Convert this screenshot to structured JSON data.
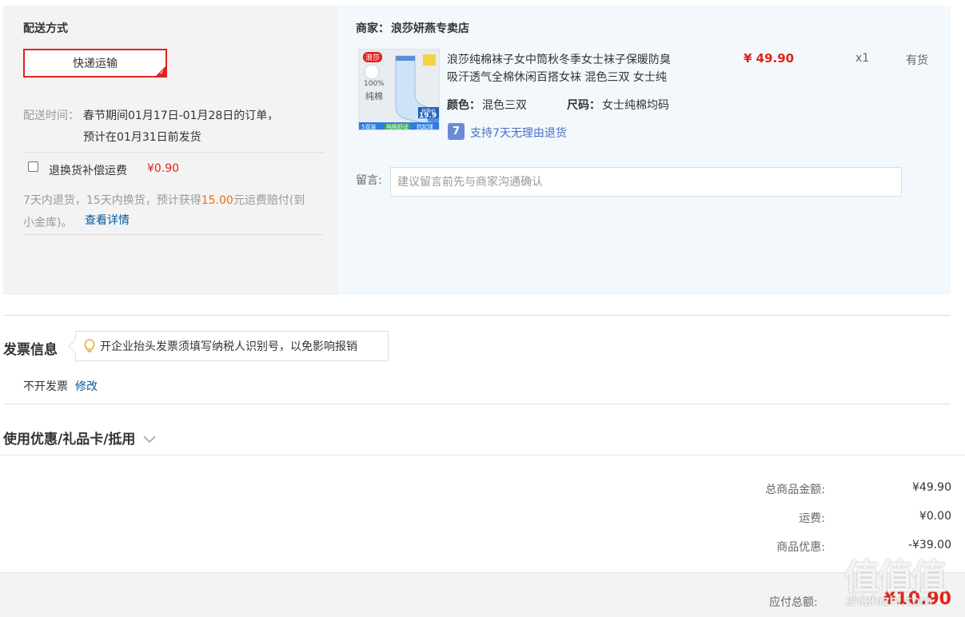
{
  "shipping": {
    "title": "配送方式",
    "method_label": "快递运输",
    "time_label": "配送时间：",
    "time_line1": "春节期间01月17日-01月28日的订单，",
    "time_line2": "预计在01月31日前发货",
    "insurance_label": "退换货补偿运费",
    "insurance_price": "¥0.90",
    "insurance_desc_1": "7天内退货，15天内换货，预计获得",
    "insurance_amount": "15.00",
    "insurance_desc_2": "元运费赔付(到",
    "insurance_desc_3": "小金库)。",
    "details_link": "查看详情"
  },
  "merchant": {
    "label": "商家：",
    "name": "浪莎妍燕专卖店"
  },
  "product": {
    "title_line1": "浪莎纯棉袜子女中筒秋冬季女士袜子保暖防臭",
    "title_line2": "吸汗透气全棉休闲百搭女袜 混色三双 女士纯",
    "price": "¥ 49.90",
    "qty": "x1",
    "stock": "有货",
    "color_label": "颜色：",
    "color_value": "混色三双",
    "size_label": "尺码：",
    "size_value": "女士纯棉均码",
    "return_badge": "7",
    "return_text": "支持7天无理由退货",
    "image_text": {
      "brand": "浪莎",
      "cotton_pct": "100%",
      "cotton": "纯棉",
      "pairs": "5双装",
      "tag1": "纯棉舒适",
      "tag2": "抗起球",
      "promo_label": "抢购价",
      "promo_price": "19.9"
    }
  },
  "note": {
    "label": "留言:",
    "placeholder": "建议留言前先与商家沟通确认"
  },
  "invoice": {
    "title": "发票信息",
    "tip": "开企业抬头发票须填写纳税人识别号，以免影响报销",
    "status": "不开发票",
    "edit": "修改"
  },
  "coupon": {
    "title": "使用优惠/礼品卡/抵用"
  },
  "summary": {
    "goods_label": "总商品金额:",
    "goods_value": "¥49.90",
    "freight_label": "运费:",
    "freight_value": "¥0.00",
    "discount_label": "商品优惠:",
    "discount_value": "-¥39.00",
    "total_label": "应付总额:",
    "total_value": "¥10.90"
  },
  "watermark": {
    "glyphs": "值值值",
    "site": "zhizhizhi.com"
  },
  "colors": {
    "accent_red": "#e2231a",
    "link_blue": "#005aa0",
    "orange": "#f26c0c"
  }
}
